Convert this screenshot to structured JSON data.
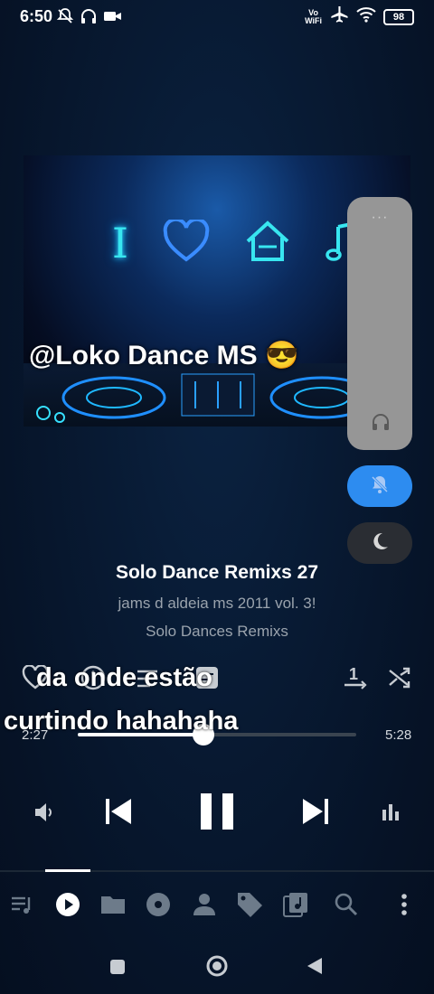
{
  "status_bar": {
    "time": "6:50",
    "vowifi_top": "Vo",
    "vowifi_bottom": "WiFi",
    "battery": "98",
    "left_icons": [
      "mute-notification-icon",
      "headphones-icon",
      "video-camera-icon"
    ],
    "right_icons": [
      "vowifi-icon",
      "airplane-icon",
      "wifi-icon",
      "battery-icon"
    ]
  },
  "album_art": {
    "caption": "@Loko Dance MS 😎",
    "neon_letter": "I",
    "neon_icons": [
      "heart-icon",
      "house-icon",
      "music-note-icon"
    ]
  },
  "side_panel": {
    "dots": "···",
    "icons": [
      "headphones-icon",
      "mute-bell-icon",
      "moon-icon"
    ],
    "accent": "#2d8cf0"
  },
  "song": {
    "title": "Solo Dance Remixs 27",
    "album": "jams d aldeia ms 2011 vol. 3!",
    "artist": "Solo Dances Remixs"
  },
  "overlay": {
    "line1": "da onde estão",
    "line2": "curtindo hahahaha"
  },
  "actions": {
    "icons": [
      "heart-outline-icon",
      "info-icon",
      "queue-list-icon",
      "lyrics-icon",
      "repeat-one-icon",
      "shuffle-icon"
    ],
    "repeat_badge": "1"
  },
  "progress": {
    "current": "2:27",
    "total": "5:28",
    "position_fraction": 0.45
  },
  "controls": {
    "icons": [
      "volume-icon",
      "previous-icon",
      "pause-icon",
      "next-icon",
      "equalizer-icon"
    ]
  },
  "bottom_nav": {
    "tabs": [
      "playlist-icon",
      "now-playing-icon",
      "folder-icon",
      "album-icon",
      "artist-icon",
      "tag-icon",
      "music-library-icon",
      "search-icon",
      "more-icon"
    ],
    "active_index": 1
  },
  "system_nav": {
    "icons": [
      "recents-square-icon",
      "home-circle-icon",
      "back-triangle-icon"
    ]
  }
}
